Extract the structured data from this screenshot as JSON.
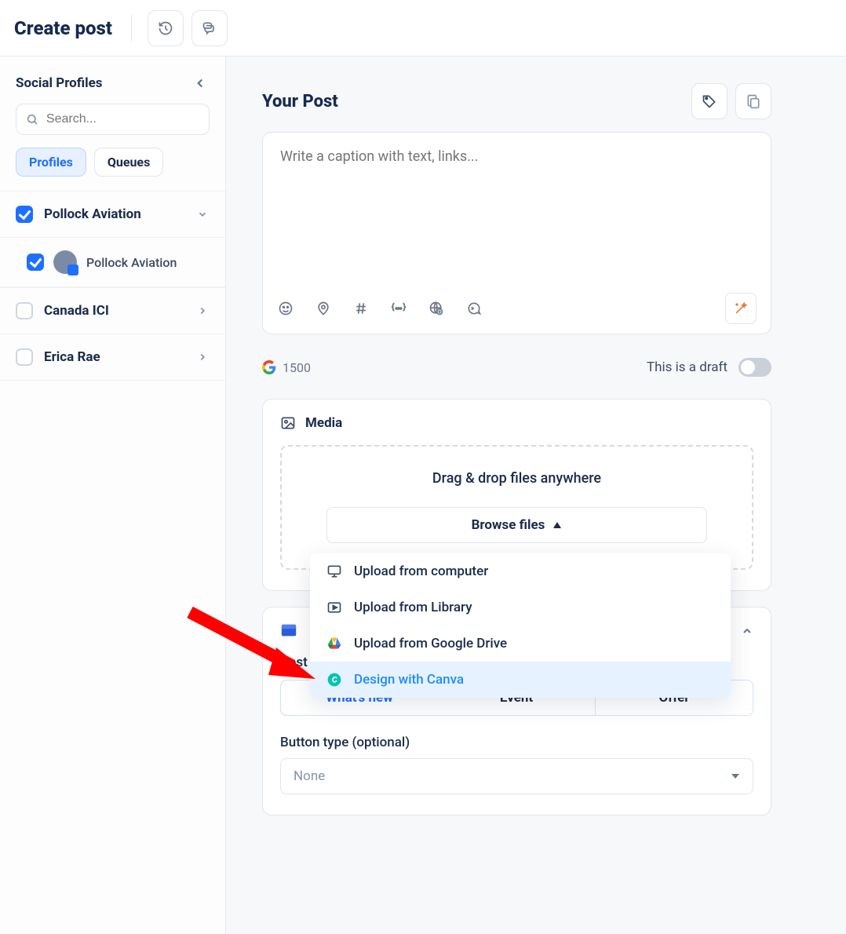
{
  "header": {
    "title": "Create post"
  },
  "sidebar": {
    "title": "Social Profiles",
    "search_placeholder": "Search...",
    "tabs": {
      "profiles": "Profiles",
      "queues": "Queues"
    },
    "groups": [
      {
        "name": "Pollock Aviation",
        "checked": true,
        "expanded": true,
        "profiles": [
          {
            "name": "Pollock Aviation",
            "checked": true
          }
        ]
      },
      {
        "name": "Canada ICI",
        "checked": false,
        "expanded": false
      },
      {
        "name": "Erica Rae",
        "checked": false,
        "expanded": false
      }
    ]
  },
  "post": {
    "heading": "Your Post",
    "placeholder": "Write a caption with text, links...",
    "char_count": "1500",
    "draft_label": "This is a draft"
  },
  "media": {
    "heading": "Media",
    "drop_text": "Drag & drop files anywhere",
    "browse_label": "Browse files",
    "menu": [
      {
        "label": "Upload from computer",
        "icon": "monitor"
      },
      {
        "label": "Upload from Library",
        "icon": "library"
      },
      {
        "label": "Upload from Google Drive",
        "icon": "gdrive"
      },
      {
        "label": "Design with Canva",
        "icon": "canva"
      }
    ]
  },
  "gbp": {
    "post_type_label": "Post",
    "segments": [
      "What's new",
      "Event",
      "Offer"
    ],
    "button_type_label": "Button type (optional)",
    "button_type_value": "None"
  }
}
